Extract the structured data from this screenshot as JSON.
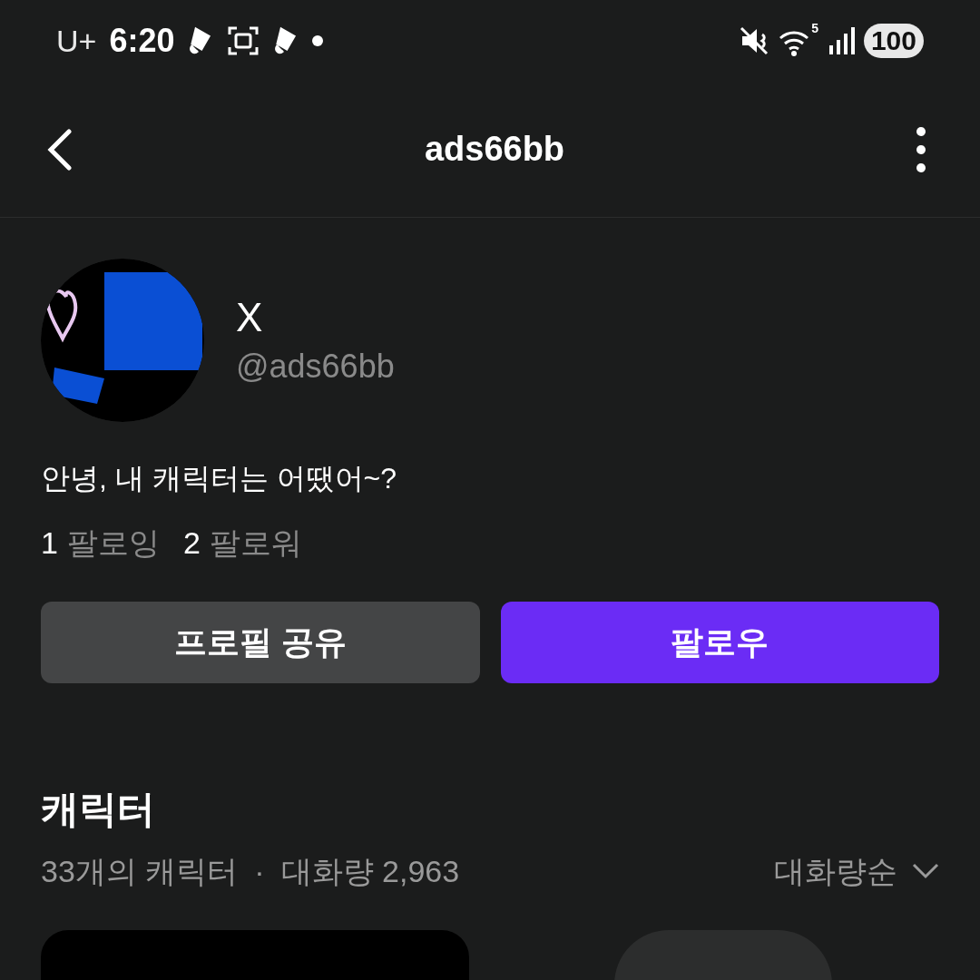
{
  "status_bar": {
    "carrier": "U+",
    "time": "6:20",
    "wifi_badge": "5",
    "battery": "100"
  },
  "header": {
    "title": "ads66bb"
  },
  "profile": {
    "name": "X",
    "handle": "@ads66bb",
    "bio": "안녕, 내 캐릭터는 어땠어~?",
    "stats": [
      {
        "count": "1",
        "label": "팔로잉"
      },
      {
        "count": "2",
        "label": "팔로워"
      }
    ]
  },
  "buttons": [
    {
      "label": "프로필 공유",
      "kind": "secondary"
    },
    {
      "label": "팔로우",
      "kind": "primary"
    }
  ],
  "characters": {
    "title": "캐릭터",
    "summary": "33개의 캐릭터",
    "separator": "·",
    "volume": "대화량 2,963",
    "sort": "대화량순"
  }
}
